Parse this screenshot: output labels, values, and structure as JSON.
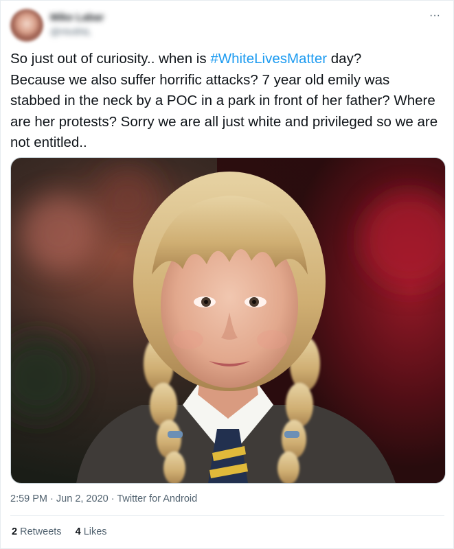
{
  "tweet": {
    "author": {
      "name": "Mike Labar",
      "handle": "@Hiv8NL"
    },
    "more_label": "···",
    "text_before": "So just out of curiosity.. when is ",
    "hashtag": "#WhiteLivesMatter",
    "text_after": " day?\nBecause we also suffer horrific attacks? 7 year old emily was stabbed in the neck by a POC in a park in front of her father? Where are her protests? Sorry we are all just white and privileged so we are not entitled..",
    "time": "2:59 PM",
    "date": "Jun 2, 2020",
    "source": "Twitter for Android",
    "separator": "·",
    "retweets_count": "2",
    "retweets_label": "Retweets",
    "likes_count": "4",
    "likes_label": "Likes"
  },
  "colors": {
    "link": "#1d9bf0",
    "text": "#0f1419",
    "secondary": "#536471",
    "border": "#e6ecf0"
  }
}
